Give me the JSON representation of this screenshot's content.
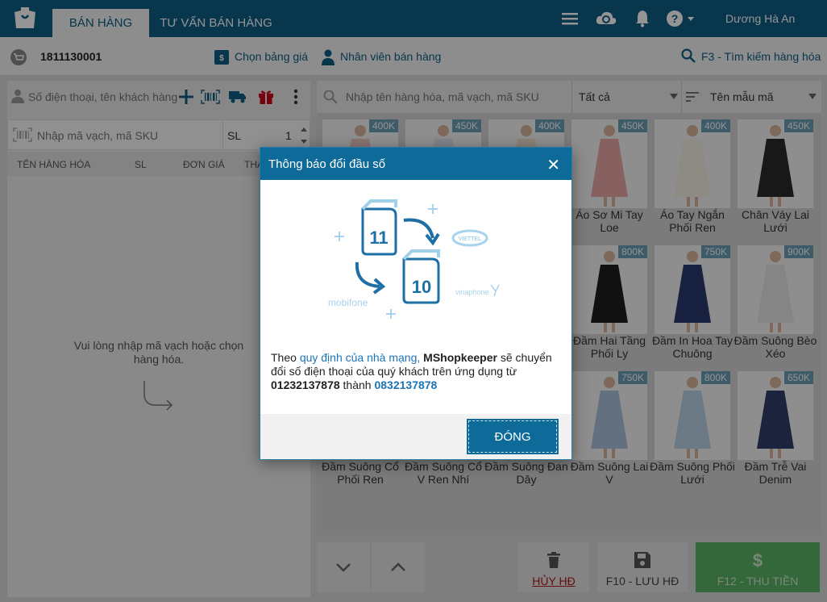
{
  "app": {
    "tabs": [
      {
        "label": "BÁN HÀNG",
        "active": true
      },
      {
        "label": "TƯ VẤN BÁN HÀNG",
        "active": false
      }
    ],
    "user_name": "Dương Hà An",
    "accent_color": "#0e5e85"
  },
  "subbar": {
    "order_number": "1811130001",
    "price_list_label": "Chọn bảng giá",
    "staff_label": "Nhân viên bán hàng",
    "search_hint": "F3 - Tìm kiếm hàng hóa"
  },
  "left": {
    "customer_placeholder": "Số điện thoại, tên khách hàng",
    "barcode_placeholder": "Nhập mã vạch, mã SKU",
    "qty_label": "SL",
    "qty_value": "1",
    "columns": [
      "TÊN HÀNG HÓA",
      "SL",
      "ĐƠN GIÁ",
      "THÀ"
    ],
    "empty_message": "Vui lòng nhập mã vạch hoặc chọn hàng hóa."
  },
  "right": {
    "search_placeholder": "Nhập tên hàng hóa, mã vạch, mã SKU",
    "category_filter": "Tất cả",
    "sort_label": "Tên mẫu mã",
    "products": [
      {
        "price": "400K",
        "name": ""
      },
      {
        "price": "450K",
        "name": ""
      },
      {
        "price": "400K",
        "name": ""
      },
      {
        "price": "450K",
        "name": "Áo Sơ Mi Tay Loe"
      },
      {
        "price": "400K",
        "name": "Áo Tay Ngắn Phối Ren"
      },
      {
        "price": "450K",
        "name": "Chân Váy Lai Lưới"
      },
      {
        "price": "",
        "name": ""
      },
      {
        "price": "",
        "name": ""
      },
      {
        "price": "",
        "name": ""
      },
      {
        "price": "800K",
        "name": "Đầm Hai Tầng Phối Ly"
      },
      {
        "price": "750K",
        "name": "Đầm In Hoa Tay Chuông"
      },
      {
        "price": "900K",
        "name": "Đầm Suông Bèo Xéo"
      },
      {
        "price": "",
        "name": "Đầm Suông Cổ Phối Ren"
      },
      {
        "price": "",
        "name": "Đầm Suông Cổ V Ren Nhí"
      },
      {
        "price": "",
        "name": "Đầm Suông Đan Dây"
      },
      {
        "price": "750K",
        "name": "Đầm Suông Lai V"
      },
      {
        "price": "800K",
        "name": "Đầm Suông Phối Lưới"
      },
      {
        "price": "650K",
        "name": "Đầm Trễ Vai Denim"
      }
    ]
  },
  "bottom": {
    "cancel_label": "HỦY HĐ",
    "save_label": "F10 - LƯU HĐ",
    "pay_label": "F12 - THU TIỀN"
  },
  "modal": {
    "title": "Thông báo đổi đầu số",
    "illustration": {
      "old_digits": "11",
      "new_digits": "10",
      "carriers": [
        "VIETTEL",
        "vinaphone",
        "mobifone"
      ]
    },
    "message_prefix": "Theo",
    "message_link": "quy định của nhà mạng,",
    "brand": "MShopkeeper",
    "message_middle": "sẽ chuyển đổi số điện thoại của quý khách trên ứng dụng từ",
    "old_number": "01232137878",
    "message_to": "thành",
    "new_number": "0832137878",
    "close_button": "ĐÓNG"
  }
}
